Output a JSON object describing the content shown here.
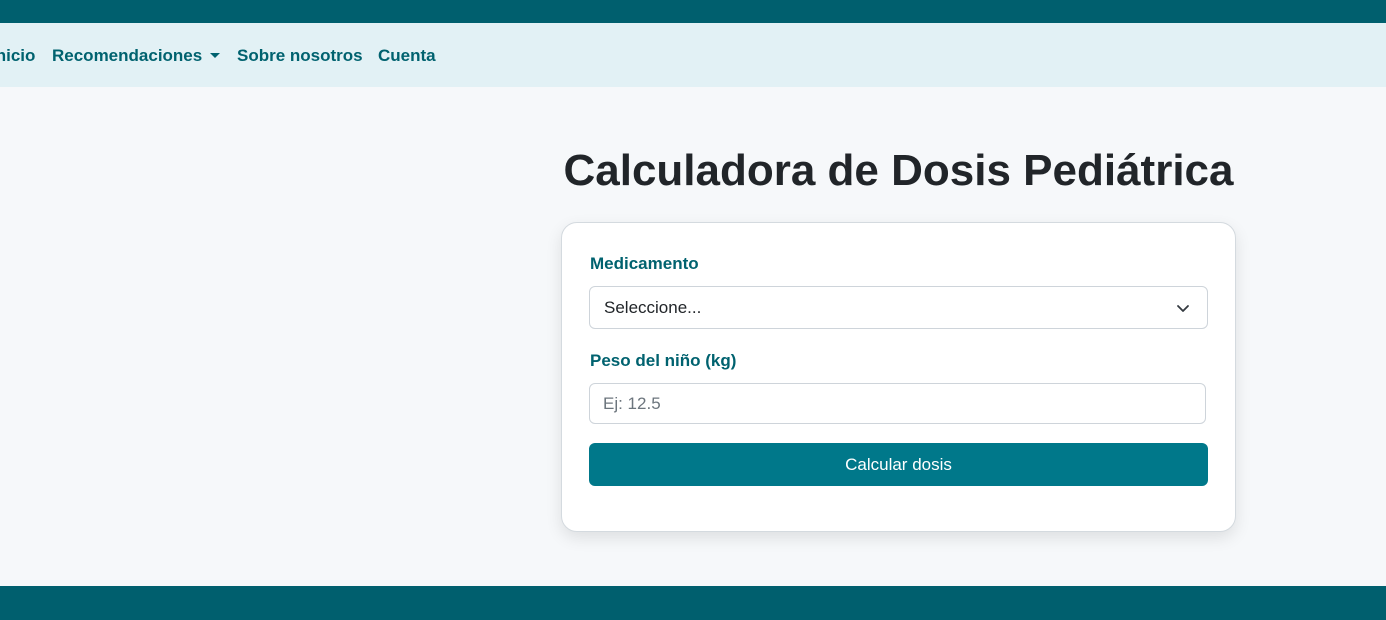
{
  "navbar": {
    "items": [
      {
        "label": "Inicio"
      },
      {
        "label": "Recomendaciones",
        "has_dropdown": true
      },
      {
        "label": "Sobre nosotros"
      },
      {
        "label": "Cuenta"
      }
    ]
  },
  "main": {
    "title": "Calculadora de Dosis Pediátrica"
  },
  "form": {
    "medication_label": "Medicamento",
    "medication_selected": "Seleccione...",
    "weight_label": "Peso del niño (kg)",
    "weight_value": "",
    "weight_placeholder": "Ej: 12.5",
    "submit_label": "Calcular dosis"
  },
  "colors": {
    "header_bar": "#005f6e",
    "navbar_bg": "#e2f1f5",
    "nav_text": "#00626f",
    "button_bg": "#00788a",
    "page_bg": "#f6f8fa"
  },
  "icons": {
    "select_chevron": "chevron-down-icon",
    "dropdown_caret": "caret-down-icon"
  }
}
